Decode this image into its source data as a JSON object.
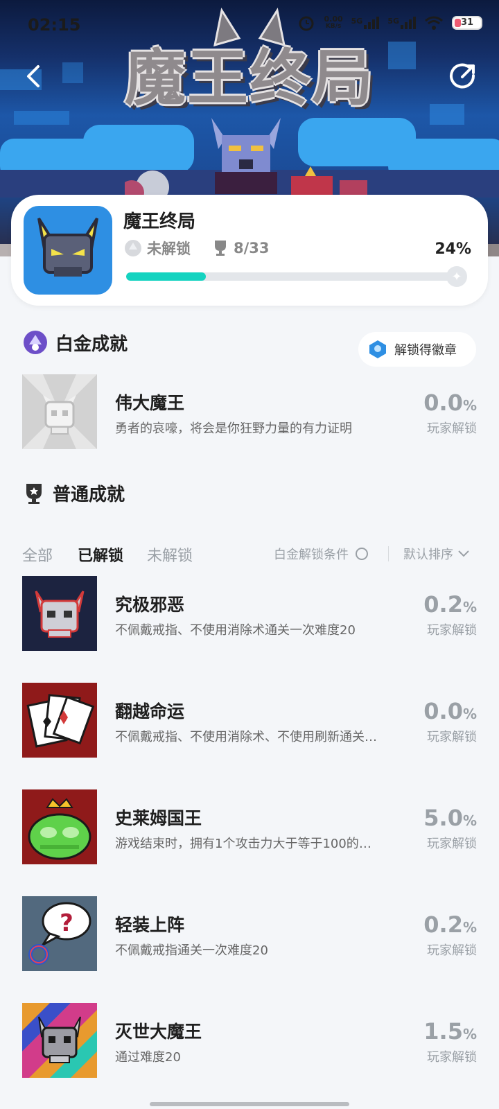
{
  "status_bar": {
    "time": "02:15",
    "net_speed": "0.00",
    "net_unit": "KB/s",
    "sig1": "5G",
    "sig2": "5G",
    "battery": "31"
  },
  "hero": {
    "title": "魔王终局"
  },
  "game": {
    "name": "魔王终局",
    "platinum_status": "未解锁",
    "trophy_count": "8/33",
    "percent_text": "24%",
    "progress": 0.24
  },
  "platinum": {
    "heading": "白金成就",
    "badge_button": "解锁得徽章",
    "item": {
      "name": "伟大魔王",
      "desc": "勇者的哀嚎，将会是你狂野力量的有力证明",
      "rate": "0.0",
      "rate_unit": "%",
      "rate_label": "玩家解锁"
    }
  },
  "normal": {
    "heading": "普通成就",
    "tabs": [
      "全部",
      "已解锁",
      "未解锁"
    ],
    "active_tab": "已解锁",
    "filter_label": "白金解锁条件",
    "sort_label": "默认排序",
    "items": [
      {
        "name": "究极邪恶",
        "desc": "不佩戴戒指、不使用消除术通关一次难度20",
        "rate": "0.2",
        "rate_unit": "%",
        "rate_label": "玩家解锁"
      },
      {
        "name": "翻越命运",
        "desc": "不佩戴戒指、不使用消除术、不使用刷新通关一次",
        "rate": "0.0",
        "rate_unit": "%",
        "rate_label": "玩家解锁"
      },
      {
        "name": "史莱姆国王",
        "desc": "游戏结束时，拥有1个攻击力大于等于100的史莱姆",
        "rate": "5.0",
        "rate_unit": "%",
        "rate_label": "玩家解锁"
      },
      {
        "name": "轻装上阵",
        "desc": "不佩戴戒指通关一次难度20",
        "rate": "0.2",
        "rate_unit": "%",
        "rate_label": "玩家解锁"
      },
      {
        "name": "灭世大魔王",
        "desc": "通过难度20",
        "rate": "1.5",
        "rate_unit": "%",
        "rate_label": "玩家解锁"
      }
    ]
  },
  "colors": {
    "accent": "#14d3c0",
    "muted": "#9aa0a6",
    "badge": "#2e8fe3"
  },
  "icons": [
    "back-arrow-icon",
    "share-icon",
    "platinum-trophy-icon",
    "trophy-icon",
    "badge-icon",
    "radio-icon",
    "chevron-down-icon"
  ]
}
